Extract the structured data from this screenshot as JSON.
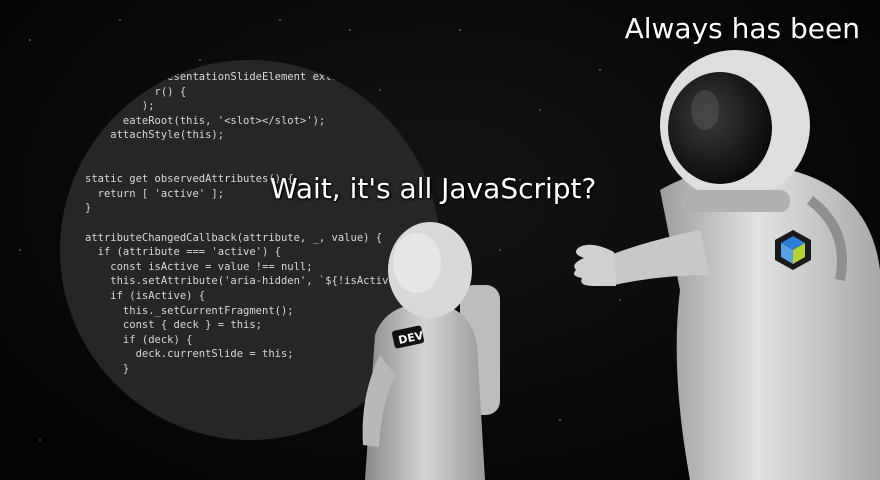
{
  "captions": {
    "top": "Always has been",
    "middle": "Wait, it's all JavaScript?"
  },
  "badge": {
    "text": "DEV"
  },
  "code_lines": [
    "             esentationSlideElement exte",
    "           r() {",
    "         );",
    "      eateRoot(this, '<slot></slot>');",
    "    attachStyle(this);",
    "",
    "",
    "static get observedAttributes() {",
    "  return [ 'active' ];",
    "}",
    "",
    "attributeChangedCallback(attribute, _, value) {",
    "  if (attribute === 'active') {",
    "    const isActive = value !== null;",
    "    this.setAttribute('aria-hidden', `${!isActive}`",
    "    if (isActive) {",
    "      this._setCurrentFragment();",
    "      const { deck } = this;",
    "      if (deck) {",
    "        deck.currentSlide = this;",
    "      }"
  ],
  "colors": {
    "code_bg": "#262626",
    "code_text": "#d7d7e0",
    "suit": "#d8d8d8",
    "logo_blue": "#2a7fd4",
    "logo_green": "#b5d334"
  },
  "icons": [
    "dev-badge-icon",
    "polymer-logo-icon"
  ]
}
